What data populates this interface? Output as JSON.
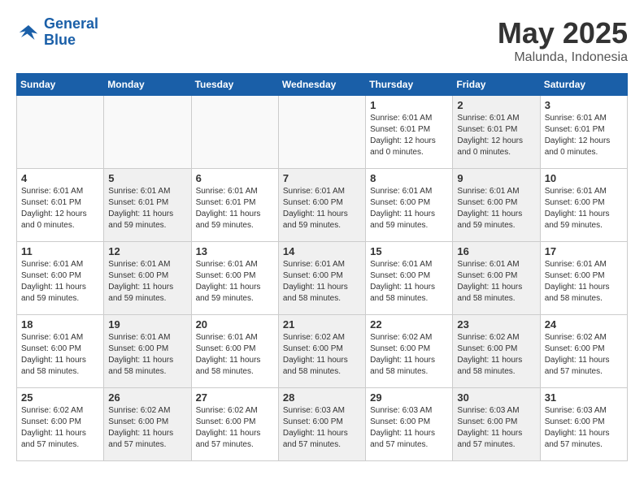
{
  "header": {
    "logo_general": "General",
    "logo_blue": "Blue",
    "month": "May 2025",
    "location": "Malunda, Indonesia"
  },
  "days_of_week": [
    "Sunday",
    "Monday",
    "Tuesday",
    "Wednesday",
    "Thursday",
    "Friday",
    "Saturday"
  ],
  "weeks": [
    [
      {
        "day": "",
        "info": "",
        "empty": true
      },
      {
        "day": "",
        "info": "",
        "empty": true
      },
      {
        "day": "",
        "info": "",
        "empty": true
      },
      {
        "day": "",
        "info": "",
        "empty": true
      },
      {
        "day": "1",
        "info": "Sunrise: 6:01 AM\nSunset: 6:01 PM\nDaylight: 12 hours\nand 0 minutes.",
        "shaded": false
      },
      {
        "day": "2",
        "info": "Sunrise: 6:01 AM\nSunset: 6:01 PM\nDaylight: 12 hours\nand 0 minutes.",
        "shaded": true
      },
      {
        "day": "3",
        "info": "Sunrise: 6:01 AM\nSunset: 6:01 PM\nDaylight: 12 hours\nand 0 minutes.",
        "shaded": false
      }
    ],
    [
      {
        "day": "4",
        "info": "Sunrise: 6:01 AM\nSunset: 6:01 PM\nDaylight: 12 hours\nand 0 minutes.",
        "shaded": false
      },
      {
        "day": "5",
        "info": "Sunrise: 6:01 AM\nSunset: 6:01 PM\nDaylight: 11 hours\nand 59 minutes.",
        "shaded": true
      },
      {
        "day": "6",
        "info": "Sunrise: 6:01 AM\nSunset: 6:01 PM\nDaylight: 11 hours\nand 59 minutes.",
        "shaded": false
      },
      {
        "day": "7",
        "info": "Sunrise: 6:01 AM\nSunset: 6:00 PM\nDaylight: 11 hours\nand 59 minutes.",
        "shaded": true
      },
      {
        "day": "8",
        "info": "Sunrise: 6:01 AM\nSunset: 6:00 PM\nDaylight: 11 hours\nand 59 minutes.",
        "shaded": false
      },
      {
        "day": "9",
        "info": "Sunrise: 6:01 AM\nSunset: 6:00 PM\nDaylight: 11 hours\nand 59 minutes.",
        "shaded": true
      },
      {
        "day": "10",
        "info": "Sunrise: 6:01 AM\nSunset: 6:00 PM\nDaylight: 11 hours\nand 59 minutes.",
        "shaded": false
      }
    ],
    [
      {
        "day": "11",
        "info": "Sunrise: 6:01 AM\nSunset: 6:00 PM\nDaylight: 11 hours\nand 59 minutes.",
        "shaded": false
      },
      {
        "day": "12",
        "info": "Sunrise: 6:01 AM\nSunset: 6:00 PM\nDaylight: 11 hours\nand 59 minutes.",
        "shaded": true
      },
      {
        "day": "13",
        "info": "Sunrise: 6:01 AM\nSunset: 6:00 PM\nDaylight: 11 hours\nand 59 minutes.",
        "shaded": false
      },
      {
        "day": "14",
        "info": "Sunrise: 6:01 AM\nSunset: 6:00 PM\nDaylight: 11 hours\nand 58 minutes.",
        "shaded": true
      },
      {
        "day": "15",
        "info": "Sunrise: 6:01 AM\nSunset: 6:00 PM\nDaylight: 11 hours\nand 58 minutes.",
        "shaded": false
      },
      {
        "day": "16",
        "info": "Sunrise: 6:01 AM\nSunset: 6:00 PM\nDaylight: 11 hours\nand 58 minutes.",
        "shaded": true
      },
      {
        "day": "17",
        "info": "Sunrise: 6:01 AM\nSunset: 6:00 PM\nDaylight: 11 hours\nand 58 minutes.",
        "shaded": false
      }
    ],
    [
      {
        "day": "18",
        "info": "Sunrise: 6:01 AM\nSunset: 6:00 PM\nDaylight: 11 hours\nand 58 minutes.",
        "shaded": false
      },
      {
        "day": "19",
        "info": "Sunrise: 6:01 AM\nSunset: 6:00 PM\nDaylight: 11 hours\nand 58 minutes.",
        "shaded": true
      },
      {
        "day": "20",
        "info": "Sunrise: 6:01 AM\nSunset: 6:00 PM\nDaylight: 11 hours\nand 58 minutes.",
        "shaded": false
      },
      {
        "day": "21",
        "info": "Sunrise: 6:02 AM\nSunset: 6:00 PM\nDaylight: 11 hours\nand 58 minutes.",
        "shaded": true
      },
      {
        "day": "22",
        "info": "Sunrise: 6:02 AM\nSunset: 6:00 PM\nDaylight: 11 hours\nand 58 minutes.",
        "shaded": false
      },
      {
        "day": "23",
        "info": "Sunrise: 6:02 AM\nSunset: 6:00 PM\nDaylight: 11 hours\nand 58 minutes.",
        "shaded": true
      },
      {
        "day": "24",
        "info": "Sunrise: 6:02 AM\nSunset: 6:00 PM\nDaylight: 11 hours\nand 57 minutes.",
        "shaded": false
      }
    ],
    [
      {
        "day": "25",
        "info": "Sunrise: 6:02 AM\nSunset: 6:00 PM\nDaylight: 11 hours\nand 57 minutes.",
        "shaded": false
      },
      {
        "day": "26",
        "info": "Sunrise: 6:02 AM\nSunset: 6:00 PM\nDaylight: 11 hours\nand 57 minutes.",
        "shaded": true
      },
      {
        "day": "27",
        "info": "Sunrise: 6:02 AM\nSunset: 6:00 PM\nDaylight: 11 hours\nand 57 minutes.",
        "shaded": false
      },
      {
        "day": "28",
        "info": "Sunrise: 6:03 AM\nSunset: 6:00 PM\nDaylight: 11 hours\nand 57 minutes.",
        "shaded": true
      },
      {
        "day": "29",
        "info": "Sunrise: 6:03 AM\nSunset: 6:00 PM\nDaylight: 11 hours\nand 57 minutes.",
        "shaded": false
      },
      {
        "day": "30",
        "info": "Sunrise: 6:03 AM\nSunset: 6:00 PM\nDaylight: 11 hours\nand 57 minutes.",
        "shaded": true
      },
      {
        "day": "31",
        "info": "Sunrise: 6:03 AM\nSunset: 6:00 PM\nDaylight: 11 hours\nand 57 minutes.",
        "shaded": false
      }
    ]
  ]
}
